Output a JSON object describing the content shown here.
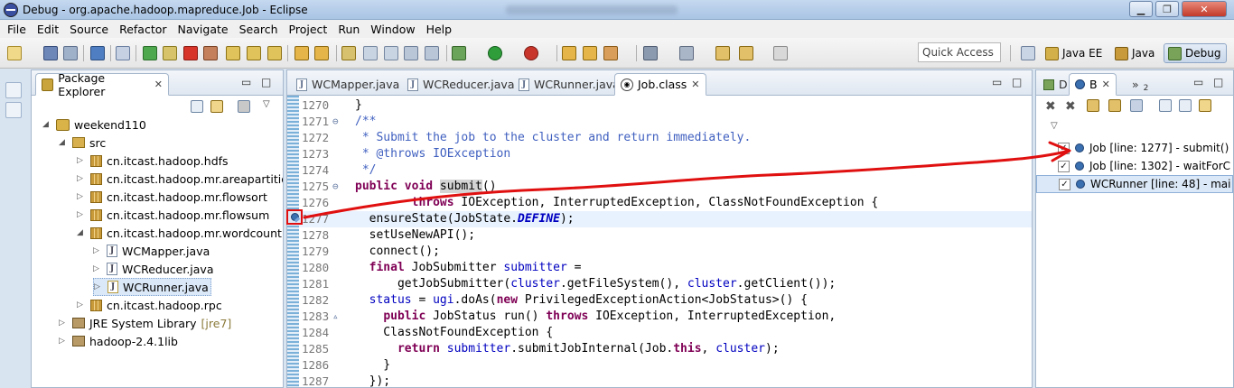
{
  "window": {
    "title": "Debug - org.apache.hadoop.mapreduce.Job - Eclipse"
  },
  "menu": [
    "File",
    "Edit",
    "Source",
    "Refactor",
    "Navigate",
    "Search",
    "Project",
    "Run",
    "Window",
    "Help"
  ],
  "toolbar": {
    "quick_access": "Quick Access"
  },
  "perspectives": [
    {
      "label": "Java EE"
    },
    {
      "label": "Java"
    },
    {
      "label": "Debug"
    }
  ],
  "package_explorer": {
    "tab_label": "Package Explorer",
    "tree": [
      {
        "label": "weekend110",
        "decor": ""
      },
      {
        "label": "src",
        "decor": ""
      },
      {
        "label": "cn.itcast.hadoop.hdfs",
        "decor": ""
      },
      {
        "label": "cn.itcast.hadoop.mr.areapartition",
        "decor": ""
      },
      {
        "label": "cn.itcast.hadoop.mr.flowsort",
        "decor": ""
      },
      {
        "label": "cn.itcast.hadoop.mr.flowsum",
        "decor": ""
      },
      {
        "label": "cn.itcast.hadoop.mr.wordcount",
        "decor": ""
      },
      {
        "label": "WCMapper.java",
        "decor": ""
      },
      {
        "label": "WCReducer.java",
        "decor": ""
      },
      {
        "label": "WCRunner.java",
        "decor": ""
      },
      {
        "label": "cn.itcast.hadoop.rpc",
        "decor": ""
      },
      {
        "label": "JRE System Library",
        "decor": "[jre7]"
      },
      {
        "label": "hadoop-2.4.1lib",
        "decor": ""
      }
    ]
  },
  "editor": {
    "tabs": [
      "WCMapper.java",
      "WCReducer.java",
      "WCRunner.java",
      "Job.class"
    ],
    "overflow": "»",
    "lines": [
      {
        "num": "1270",
        "fold": "",
        "code": "}"
      },
      {
        "num": "1271",
        "fold": "⊖",
        "code": "/**"
      },
      {
        "num": "1272",
        "fold": "",
        "code": " * Submit the job to the cluster and return immediately."
      },
      {
        "num": "1273",
        "fold": "",
        "code": " * @throws IOException"
      },
      {
        "num": "1274",
        "fold": "",
        "code": " */"
      },
      {
        "num": "1275",
        "fold": "⊖",
        "code": "public void submit()"
      },
      {
        "num": "1276",
        "fold": "",
        "code": "        throws IOException, InterruptedException, ClassNotFoundException {"
      },
      {
        "num": "1277",
        "fold": "",
        "code": "  ensureState(JobState.DEFINE);"
      },
      {
        "num": "1278",
        "fold": "",
        "code": "  setUseNewAPI();"
      },
      {
        "num": "1279",
        "fold": "",
        "code": "  connect();"
      },
      {
        "num": "1280",
        "fold": "",
        "code": "  final JobSubmitter submitter ="
      },
      {
        "num": "1281",
        "fold": "",
        "code": "      getJobSubmitter(cluster.getFileSystem(), cluster.getClient());"
      },
      {
        "num": "1282",
        "fold": "",
        "code": "  status = ugi.doAs(new PrivilegedExceptionAction<JobStatus>() {"
      },
      {
        "num": "1283",
        "fold": "▵",
        "code": "    public JobStatus run() throws IOException, InterruptedException,"
      },
      {
        "num": "1284",
        "fold": "",
        "code": "    ClassNotFoundException {"
      },
      {
        "num": "1285",
        "fold": "",
        "code": "      return submitter.submitJobInternal(Job.this, cluster);"
      },
      {
        "num": "1286",
        "fold": "",
        "code": "    }"
      },
      {
        "num": "1287",
        "fold": "",
        "code": "  });"
      }
    ]
  },
  "debug_panel": {
    "tabs": [
      "D",
      "B",
      "»",
      "2"
    ],
    "breakpoints": [
      {
        "checked": "✓",
        "label": "Job [line: 1277] - submit()"
      },
      {
        "checked": "✓",
        "label": "Job [line: 1302] - waitForC"
      },
      {
        "checked": "✓",
        "label": "WCRunner [line: 48] - mai"
      }
    ]
  },
  "annotation": {
    "color": "#e01010"
  }
}
